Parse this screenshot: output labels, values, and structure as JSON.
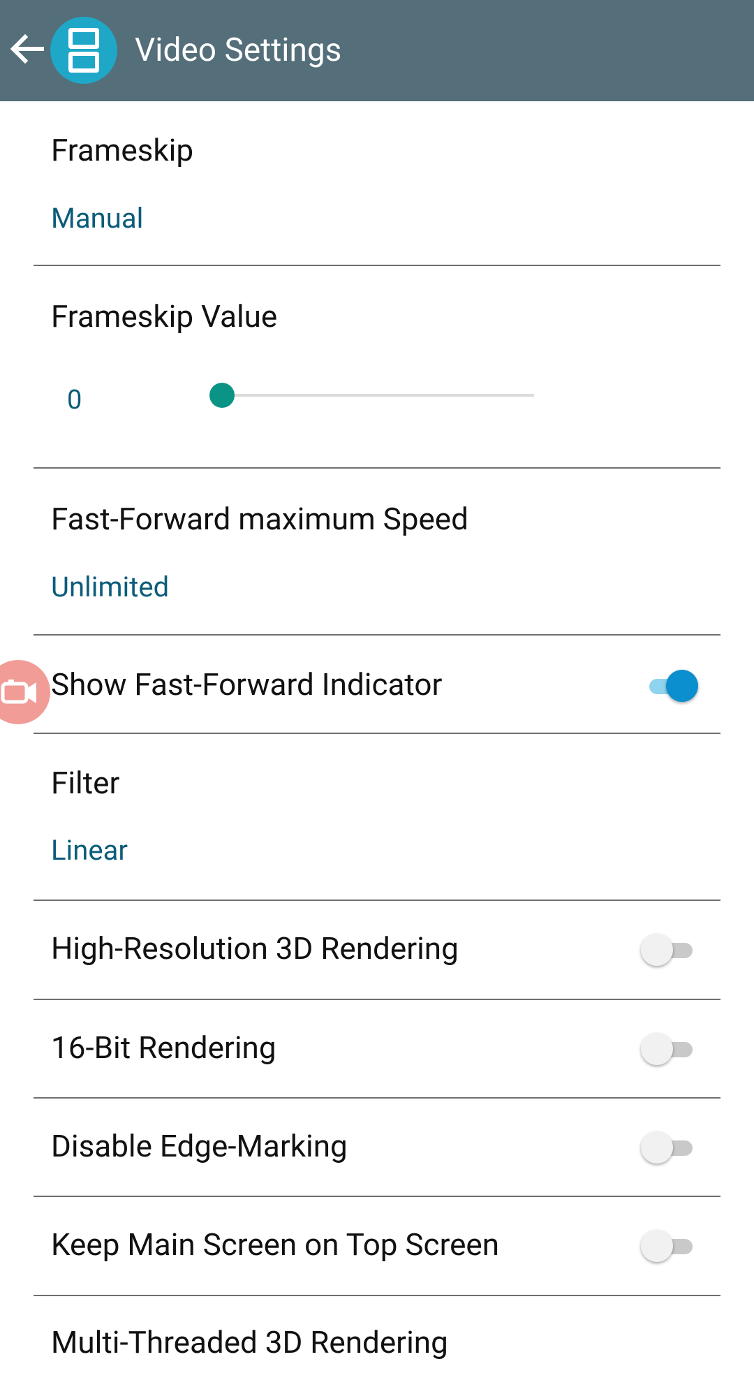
{
  "appbar": {
    "title": "Video Settings",
    "back_icon": "arrow-back-icon",
    "app_icon": "nintendo-ds-icon"
  },
  "colors": {
    "appbar_bg": "#546e7a",
    "value_text": "#0c5c7a",
    "switch_on": "#0b8fcf",
    "slider_knob": "#0a9486"
  },
  "settings": {
    "frameskip": {
      "label": "Frameskip",
      "value": "Manual"
    },
    "frameskip_value": {
      "label": "Frameskip Value",
      "value": "0"
    },
    "ff_speed": {
      "label": "Fast-Forward maximum Speed",
      "value": "Unlimited"
    },
    "ff_indicator": {
      "label": "Show Fast-Forward Indicator",
      "checked": true
    },
    "filter": {
      "label": "Filter",
      "value": "Linear"
    },
    "high_res": {
      "label": "High-Resolution 3D Rendering",
      "checked": false
    },
    "bit16": {
      "label": "16-Bit Rendering",
      "checked": false
    },
    "edge_marking": {
      "label": "Disable Edge-Marking",
      "checked": false
    },
    "main_screen_top": {
      "label": "Keep Main Screen on Top Screen",
      "checked": false
    },
    "multithread": {
      "label": "Multi-Threaded 3D Rendering"
    }
  }
}
